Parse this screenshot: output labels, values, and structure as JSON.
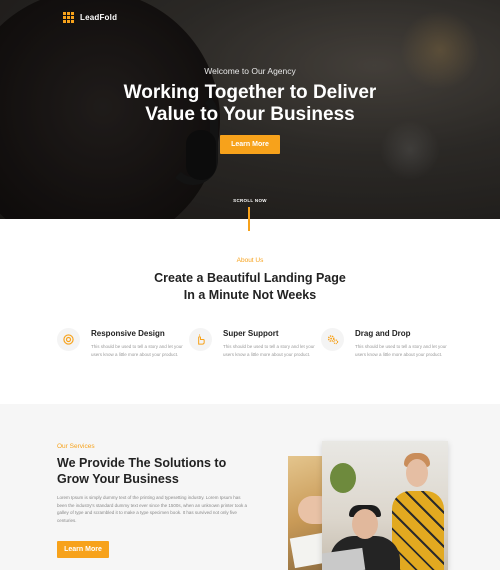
{
  "brand": {
    "name": "LeadFold",
    "accent": "#f7a21b"
  },
  "hero": {
    "subtitle": "Welcome to Our Agency",
    "title_line1": "Working Together to Deliver",
    "title_line2": "Value to Your Business",
    "button_label": "Learn More",
    "scroll_label": "SCROLL NOW"
  },
  "about": {
    "eyebrow": "About Us",
    "title_line1": "Create a Beautiful Landing Page",
    "title_line2": "In a Minute Not Weeks",
    "features": [
      {
        "icon": "target-icon",
        "title": "Responsive Design",
        "text": "This should be used to tell a story and let your users know a little more about your product."
      },
      {
        "icon": "pointer-hand-icon",
        "title": "Super Support",
        "text": "This should be used to tell a story and let your users know a little more about your product."
      },
      {
        "icon": "cogs-icon",
        "title": "Drag and Drop",
        "text": "This should be used to tell a story and let your users know a little more about your product."
      }
    ]
  },
  "services": {
    "eyebrow": "Our Services",
    "title_line1": "We Provide The Solutions to",
    "title_line2": "Grow Your Business",
    "text": "Lorem Ipsum is simply dummy text of the printing and typesetting industry. Lorem Ipsum has been the industry's standard dummy text ever since the 1500s, when an unknown printer took a galley of type and scrambled it to make a type specimen book. It has survived not only five centuries.",
    "button_label": "Learn More"
  }
}
